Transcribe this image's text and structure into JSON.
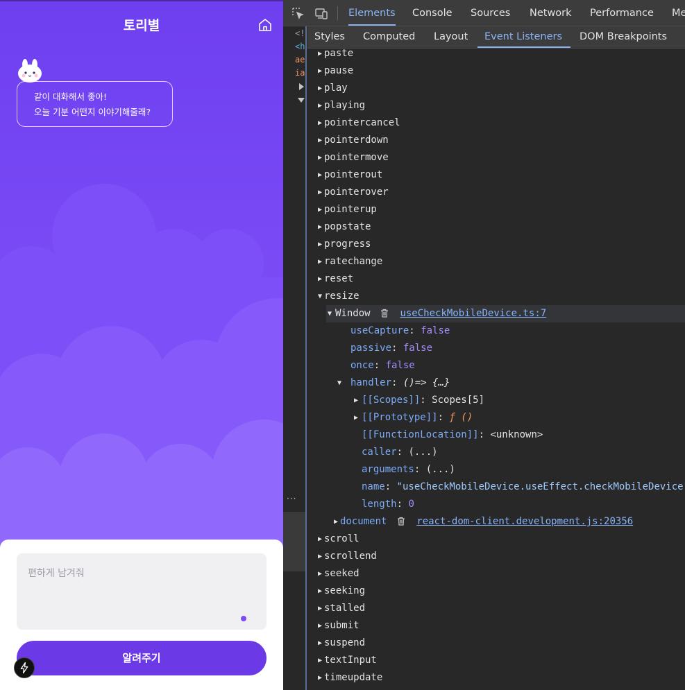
{
  "app": {
    "title": "토리별",
    "bubble": {
      "line1": "같이 대화해서 좋아!",
      "line2": "오늘 기분 어떤지 이야기해줄래?"
    },
    "input_placeholder": "편하게 남겨줘",
    "submit_label": "알려주기",
    "colors": {
      "accent": "#6b3ae6",
      "background_top": "#6e3ff0"
    }
  },
  "devtools": {
    "main_tabs": [
      "Elements",
      "Console",
      "Sources",
      "Network",
      "Performance",
      "Me"
    ],
    "active_main_tab": "Elements",
    "dom_fragments": [
      "<!",
      "<h",
      "ae",
      "ia"
    ],
    "sub_tabs": [
      "Styles",
      "Computed",
      "Layout",
      "Event Listeners",
      "DOM Breakpoints"
    ],
    "active_sub_tab": "Event Listeners",
    "events_before": [
      "paste",
      "pause",
      "play",
      "playing",
      "pointercancel",
      "pointerdown",
      "pointermove",
      "pointerout",
      "pointerover",
      "pointerup",
      "popstate",
      "progress",
      "ratechange",
      "reset"
    ],
    "expanded_event": "resize",
    "window_listener": {
      "target": "Window",
      "source": "useCheckMobileDevice.ts:7",
      "props": [
        {
          "key": "useCapture",
          "value": "false"
        },
        {
          "key": "passive",
          "value": "false"
        },
        {
          "key": "once",
          "value": "false"
        }
      ],
      "handler_key": "handler",
      "handler_value": "()=> {…}",
      "handler_props": {
        "scopes_key": "[[Scopes]]",
        "scopes_value": "Scopes[5]",
        "prototype_key": "[[Prototype]]",
        "prototype_value": "ƒ ()",
        "location_key": "[[FunctionLocation]]",
        "location_value": "<unknown>",
        "caller_key": "caller",
        "caller_value": "(...)",
        "arguments_key": "arguments",
        "arguments_value": "(...)",
        "name_key": "name",
        "name_value": "\"useCheckMobileDevice.useEffect.checkMobileDevice\"",
        "length_key": "length",
        "length_value": "0"
      }
    },
    "document_listener": {
      "target": "document",
      "source": "react-dom-client.development.js:20356"
    },
    "events_after": [
      "scroll",
      "scrollend",
      "seeked",
      "seeking",
      "stalled",
      "submit",
      "suspend",
      "textInput",
      "timeupdate"
    ],
    "colors": {
      "accent": "#8ab4f8",
      "panel_bg": "#282828",
      "toolbar_bg": "#3c3c3c"
    }
  }
}
